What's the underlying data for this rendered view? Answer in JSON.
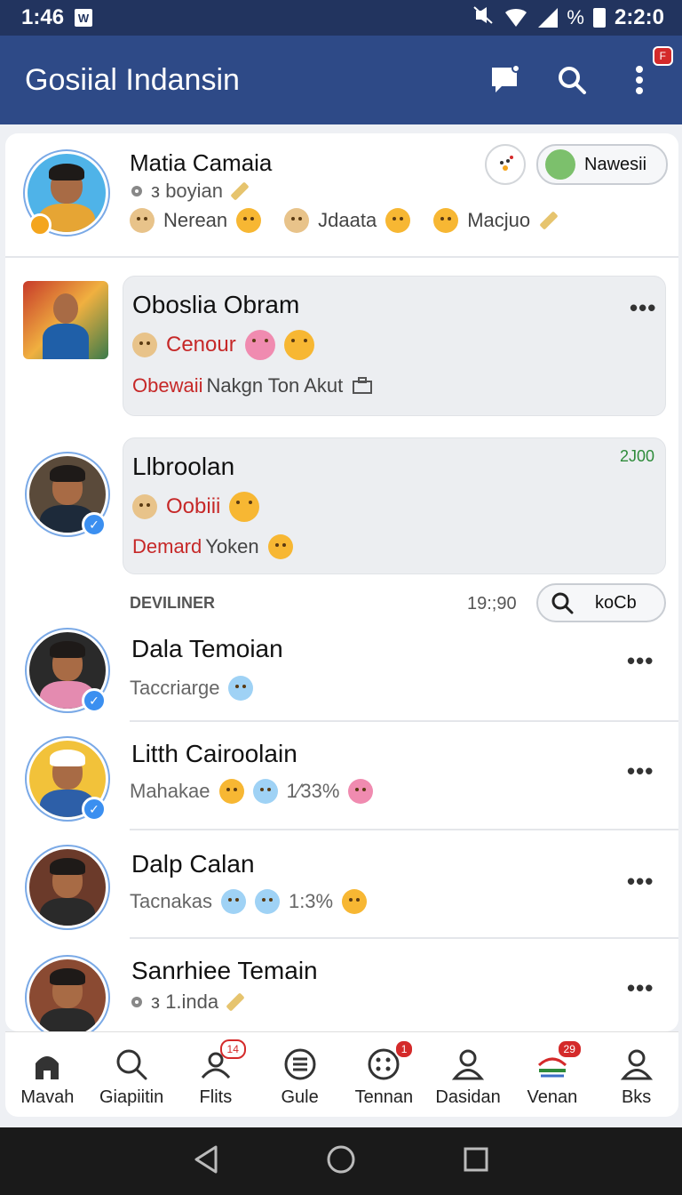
{
  "status_bar": {
    "time": "1:46",
    "notif_letter": "W",
    "battery_pct": "%",
    "clock": "2:2:0"
  },
  "app_bar": {
    "title": "Gosiial Indansin",
    "badge": "F"
  },
  "profile": {
    "name": "Matia Camaia",
    "sub": "з boyian",
    "tags": [
      "Nerean",
      "Jdaata",
      "Macjuo"
    ],
    "pill_label": "Nawesii"
  },
  "posts": [
    {
      "name": "Oboslia Obram",
      "line1": "Cenour",
      "line2_red": "Obewaii",
      "line2": "Nakgn Ton Akut"
    },
    {
      "name": "Llbroolan",
      "count": "2J00",
      "line1": "Oobiii",
      "line2_red": "Demard",
      "line2": "Yoken"
    }
  ],
  "section": {
    "title": "DEVILINER",
    "time": "19:;90",
    "search_label": "koCb"
  },
  "list": [
    {
      "name": "Dala Temoian",
      "detail": "Taccriarge",
      "stat": ""
    },
    {
      "name": "Litth Cairoolain",
      "detail": "Mahakae",
      "stat": "1⁄33%"
    },
    {
      "name": "Dalp Calan",
      "detail": "Tacnakas",
      "stat": "1:3%"
    },
    {
      "name": "Sanrhiee Temain",
      "detail": "з 1.inda",
      "stat": ""
    }
  ],
  "bottom_nav": [
    {
      "label": "Mavah",
      "icon": "home-icon",
      "badge": ""
    },
    {
      "label": "Giapiitin",
      "icon": "search-icon",
      "badge": ""
    },
    {
      "label": "Flits",
      "icon": "people-icon",
      "badge": "14"
    },
    {
      "label": "Gule",
      "icon": "menu-circle-icon",
      "badge": ""
    },
    {
      "label": "Tennan",
      "icon": "dice-icon",
      "badge": "1"
    },
    {
      "label": "Dasidan",
      "icon": "person-icon",
      "badge": ""
    },
    {
      "label": "Venan",
      "icon": "flag-icon",
      "badge": "29"
    },
    {
      "label": "Bks",
      "icon": "profile-icon",
      "badge": ""
    }
  ],
  "colors": {
    "app_bar": "#2e4a87",
    "status_bar": "#22345f",
    "accent_red": "#c62828",
    "verified_blue": "#3b8ff0"
  }
}
